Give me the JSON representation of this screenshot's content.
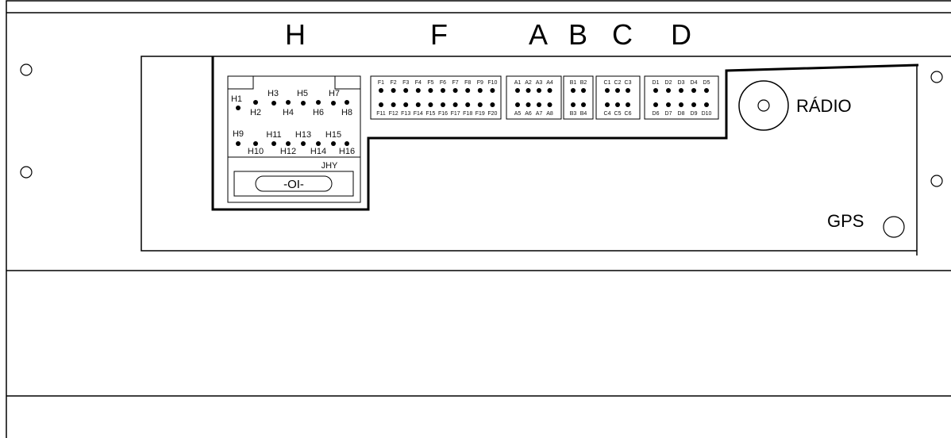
{
  "group_headers": [
    "H",
    "F",
    "A",
    "B",
    "C",
    "D"
  ],
  "radio_label": "RÁDIO",
  "gps_label": "GPS",
  "jhy_label": "JHY",
  "fuse_symbol": "-OI-",
  "connector_h": {
    "top_row": [
      "H1",
      "H3",
      "H5",
      "H7"
    ],
    "bottom_row": [
      "H2",
      "H4",
      "H6",
      "H8"
    ],
    "top_row_2": [
      "H9",
      "H11",
      "H13",
      "H15"
    ],
    "bottom_row_2": [
      "H10",
      "H12",
      "H14",
      "H16"
    ]
  },
  "connector_f": {
    "top": [
      "F1",
      "F2",
      "F3",
      "F4",
      "F5",
      "F6",
      "F7",
      "F8",
      "F9",
      "F10"
    ],
    "bottom": [
      "F11",
      "F12",
      "F13",
      "F14",
      "F15",
      "F16",
      "F17",
      "F18",
      "F19",
      "F20"
    ]
  },
  "connector_a": {
    "top": [
      "A1",
      "A2",
      "A3",
      "A4"
    ],
    "bottom": [
      "A5",
      "A6",
      "A7",
      "A8"
    ]
  },
  "connector_b": {
    "top": [
      "B1",
      "B2"
    ],
    "bottom": [
      "B3",
      "B4"
    ]
  },
  "connector_c": {
    "top": [
      "C1",
      "C2",
      "C3"
    ],
    "bottom": [
      "C4",
      "C5",
      "C6"
    ]
  },
  "connector_d": {
    "top": [
      "D1",
      "D2",
      "D3",
      "D4",
      "D5"
    ],
    "bottom": [
      "D6",
      "D7",
      "D8",
      "D9",
      "D10"
    ]
  }
}
